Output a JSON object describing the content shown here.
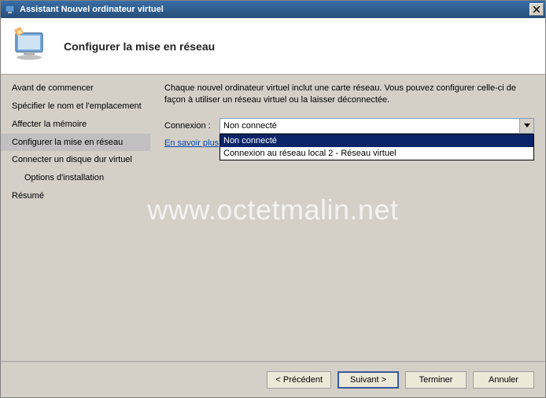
{
  "window": {
    "title": "Assistant Nouvel ordinateur virtuel"
  },
  "header": {
    "title": "Configurer la mise en réseau"
  },
  "sidebar": {
    "items": [
      {
        "label": "Avant de commencer"
      },
      {
        "label": "Spécifier le nom et l'emplacement"
      },
      {
        "label": "Affecter la mémoire"
      },
      {
        "label": "Configurer la mise en réseau"
      },
      {
        "label": "Connecter un disque dur virtuel"
      },
      {
        "label": "Options d'installation"
      },
      {
        "label": "Résumé"
      }
    ]
  },
  "content": {
    "description": "Chaque nouvel ordinateur virtuel inclut une carte réseau. Vous pouvez configurer celle-ci de façon à utiliser un réseau virtuel ou la laisser déconnectée.",
    "conn_label": "Connexion :",
    "conn_value": "Non connecté",
    "dropdown": {
      "opt0": "Non connecté",
      "opt1": "Connexion au réseau local 2 - Réseau virtuel"
    },
    "more_link": "En savoir plus"
  },
  "footer": {
    "prev": "< Précédent",
    "next": "Suivant >",
    "finish": "Terminer",
    "cancel": "Annuler"
  },
  "watermark": "www.octetmalin.net"
}
